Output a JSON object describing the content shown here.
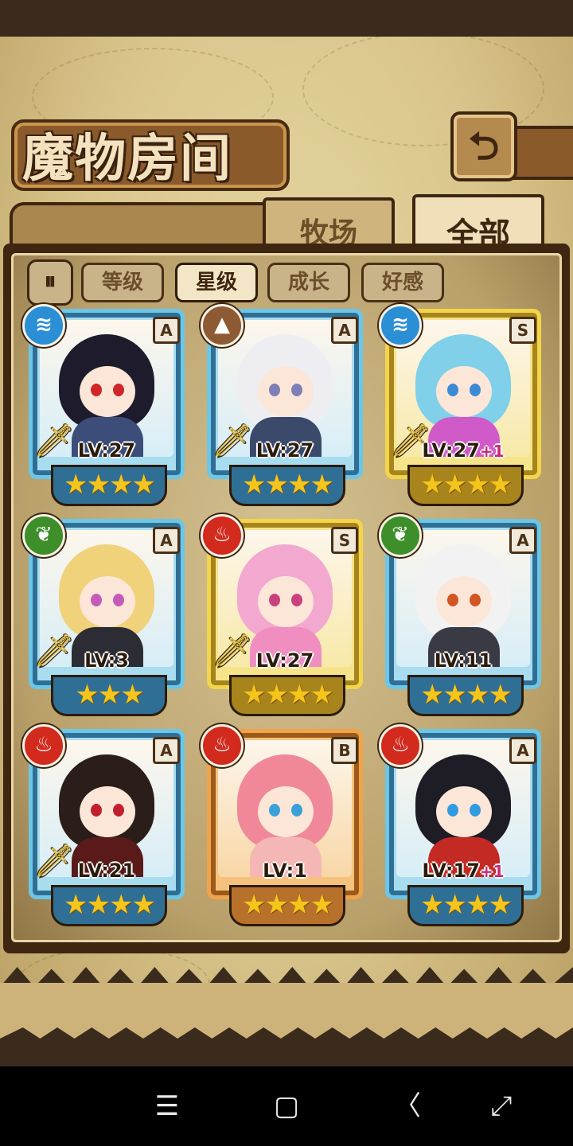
{
  "title": "魔物房间",
  "back_icon": "return-arrow-icon",
  "tabs": {
    "farm": "牧场",
    "all": "全部",
    "active": "all"
  },
  "sort": {
    "toggle_label": "⇂",
    "chips": [
      {
        "label": "等级",
        "active": false
      },
      {
        "label": "星级",
        "active": true
      },
      {
        "label": "成长",
        "active": false
      },
      {
        "label": "好感",
        "active": false
      }
    ]
  },
  "cards": [
    {
      "element": "water",
      "element_glyph": "≋",
      "rank": "A",
      "level": "LV:27",
      "plus": "",
      "stars": "★★★★",
      "weapon": true,
      "frame": "blue",
      "hair": "#1d1b2c",
      "eye": "#d0262a",
      "outfit": "#3c4d7a"
    },
    {
      "element": "earth",
      "element_glyph": "▲",
      "rank": "A",
      "level": "LV:27",
      "plus": "",
      "stars": "★★★★",
      "weapon": true,
      "frame": "blue",
      "hair": "#eeeef2",
      "eye": "#7d7fb6",
      "outfit": "#3b4a6b"
    },
    {
      "element": "water",
      "element_glyph": "≋",
      "rank": "S",
      "level": "LV:27",
      "plus": "+1",
      "stars": "★★★★",
      "weapon": true,
      "frame": "gold",
      "hair": "#7fd0e8",
      "eye": "#3a8bd4",
      "outfit": "#d15ac9"
    },
    {
      "element": "wood",
      "element_glyph": "❦",
      "rank": "A",
      "level": "LV:3",
      "plus": "",
      "stars": "★★★",
      "weapon": true,
      "frame": "blue",
      "hair": "#f0d27a",
      "eye": "#c45bb8",
      "outfit": "#2c2c35"
    },
    {
      "element": "fire",
      "element_glyph": "♨",
      "rank": "S",
      "level": "LV:27",
      "plus": "",
      "stars": "★★★★",
      "weapon": true,
      "frame": "gold",
      "hair": "#f3a8cf",
      "eye": "#c9427e",
      "outfit": "#f08ec1"
    },
    {
      "element": "wood",
      "element_glyph": "❦",
      "rank": "A",
      "level": "LV:11",
      "plus": "",
      "stars": "★★★★",
      "weapon": false,
      "frame": "blue",
      "hair": "#f2f2f2",
      "eye": "#d1561f",
      "outfit": "#3a3a44"
    },
    {
      "element": "fire",
      "element_glyph": "♨",
      "rank": "A",
      "level": "LV:21",
      "plus": "",
      "stars": "★★★★",
      "weapon": true,
      "frame": "blue",
      "hair": "#2a1d1a",
      "eye": "#c21f2e",
      "outfit": "#5a1a1a"
    },
    {
      "element": "fire",
      "element_glyph": "♨",
      "rank": "B",
      "level": "LV:1",
      "plus": "",
      "stars": "★★★★",
      "weapon": false,
      "frame": "orange",
      "hair": "#f0889a",
      "eye": "#3aa1d8",
      "outfit": "#f5b7b5"
    },
    {
      "element": "fire",
      "element_glyph": "♨",
      "rank": "A",
      "level": "LV:17",
      "plus": "+1",
      "stars": "★★★★",
      "weapon": false,
      "frame": "blue",
      "hair": "#1e1c24",
      "eye": "#2f9be0",
      "outfit": "#c42a24"
    }
  ],
  "nav": {
    "menu": "☰",
    "home": "▢",
    "back": "〈",
    "resize": "⤢"
  }
}
